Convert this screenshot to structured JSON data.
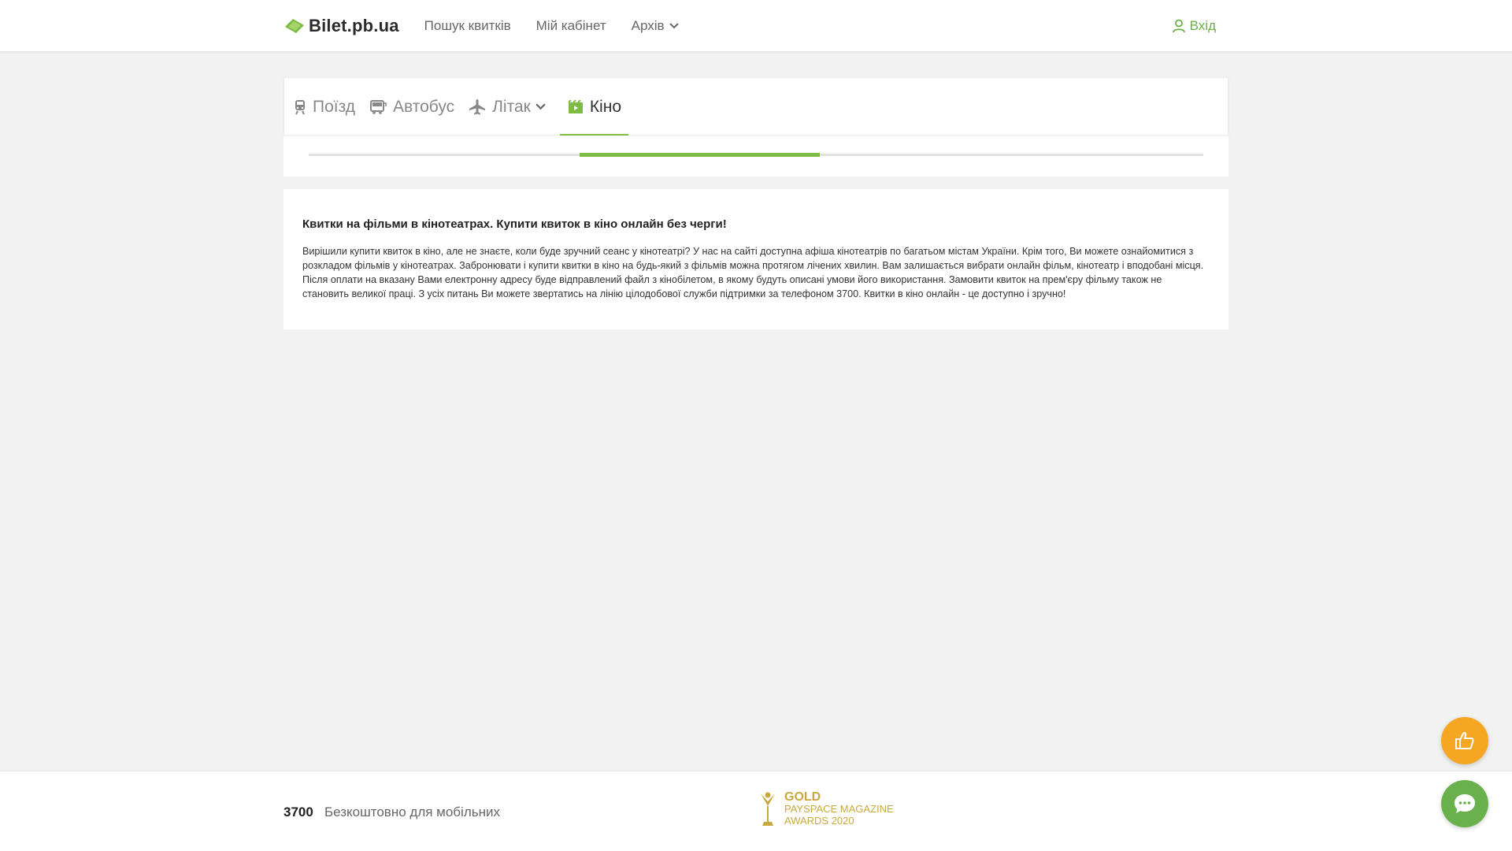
{
  "header": {
    "logo_text": "Bilet.pb.ua",
    "nav": [
      {
        "label": "Пошук квитків"
      },
      {
        "label": "Мій кабінет"
      },
      {
        "label": "Архів"
      }
    ],
    "login_label": "Вхід"
  },
  "tabs": [
    {
      "label": "Поїзд",
      "icon": "train-icon"
    },
    {
      "label": "Автобус",
      "icon": "bus-icon"
    },
    {
      "label": "Літак",
      "icon": "plane-icon"
    },
    {
      "label": "Кіно",
      "icon": "cinema-icon",
      "active": true
    }
  ],
  "progress": {
    "value": 0.34
  },
  "info": {
    "title": "Квитки на фільми в кінотеатрах. Купити квиток в кіно онлайн без черги!",
    "text": "Вирішили купити квиток в кіно, але не знаєте, коли буде зручний сеанс у кінотеатрі? У нас на сайті доступна афіша кінотеатрів по багатьом містам України. Крім того, Ви можете ознайомитися з розкладом фільмів у кінотеатрах. Забронювати і купити квитки в кіно на будь-який з фільмів можна протягом лічених хвилин. Вам залишається вибрати онлайн фільм, кінотеатр і вподобані місця. Після оплати на вказану Вами електронну адресу буде відправлений файл з кінобілетом, в якому будуть описані умови його використання. Замовити квиток на прем'єру фільму також не становить великої праці. З усіх питань Ви можете звертатись на лінію цілодобової служби підтримки за телефоном 3700. Квитки в кіно онлайн - це доступно і зручно!"
  },
  "footer": {
    "phone": "3700",
    "phone_note": "Безкоштовно для мобільних",
    "award_line1": "GOLD",
    "award_line2": "PAYSPACE MAGAZINE",
    "award_line3": "AWARDS 2020"
  },
  "colors": {
    "accent": "#7dbb42",
    "login": "#6ab04c",
    "like_button": "#f5a623",
    "chat_button": "#6ab04c",
    "award_gold": "#c9a93d"
  }
}
